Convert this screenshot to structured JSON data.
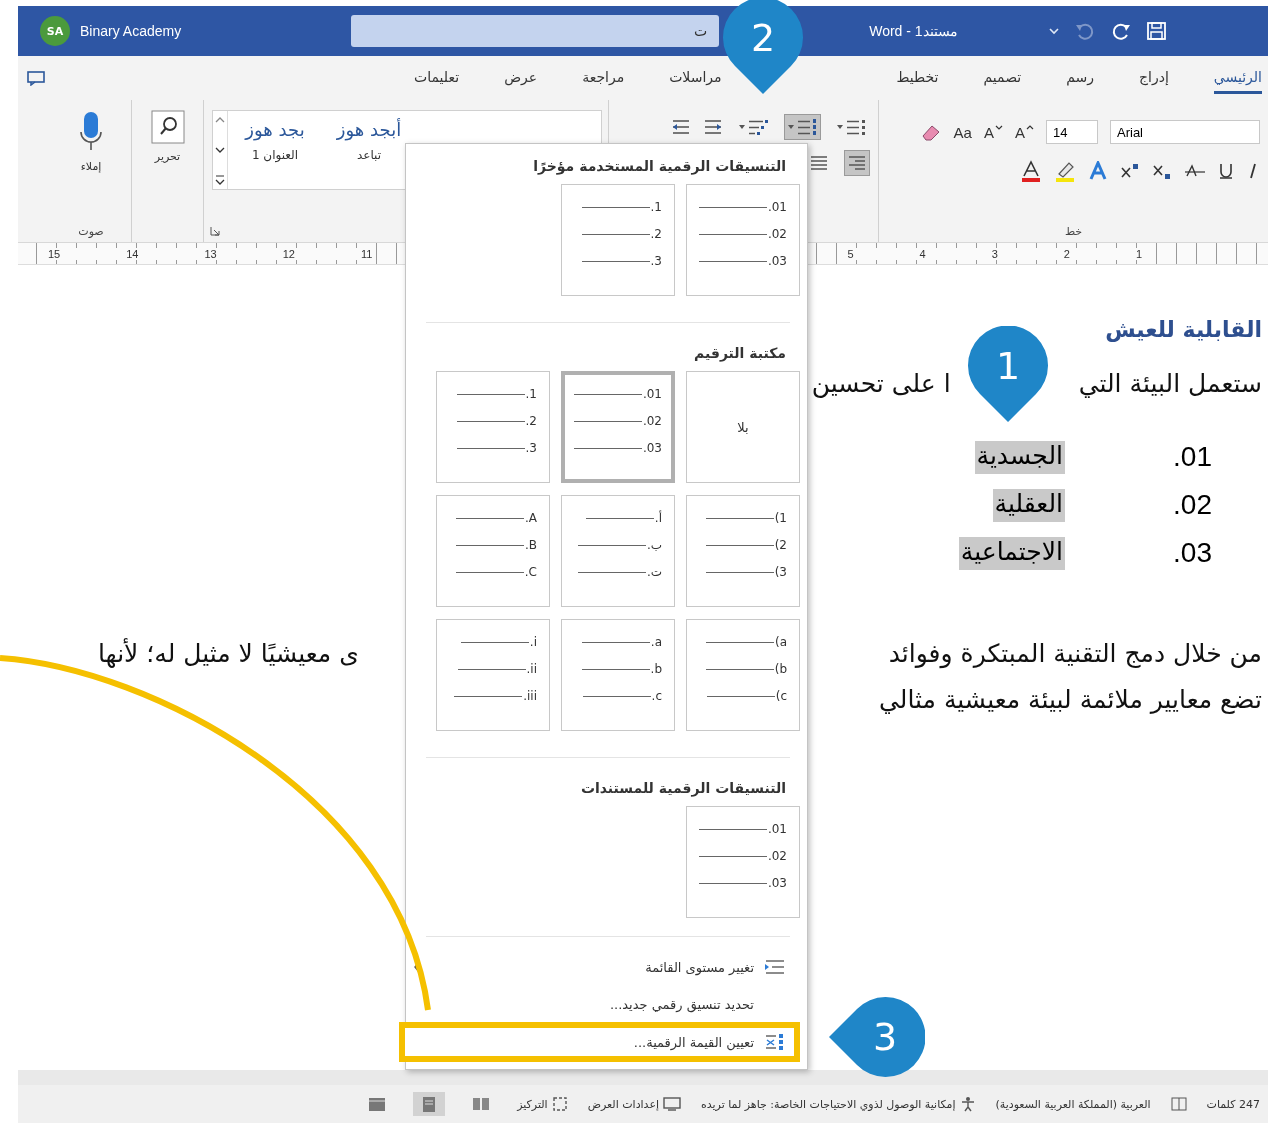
{
  "title_bar": {
    "avatar": "SA",
    "account": "Binary Academy",
    "search_text": "ت",
    "document_title": "Word - مستند1"
  },
  "tabs": [
    {
      "label": "الرئيسي",
      "selected": true
    },
    {
      "label": "إدراج",
      "selected": false
    },
    {
      "label": "رسم",
      "selected": false
    },
    {
      "label": "تصميم",
      "selected": false
    },
    {
      "label": "تخطيط",
      "selected": false
    },
    {
      "label": "مراسلات",
      "selected": false
    },
    {
      "label": "مراجعة",
      "selected": false
    },
    {
      "label": "عرض",
      "selected": false
    },
    {
      "label": "تعليمات",
      "selected": false
    }
  ],
  "ribbon": {
    "font": {
      "font_name": "Arial",
      "font_size": "14",
      "buttons": [
        {
          "kind": "grow",
          "label": "A"
        },
        {
          "kind": "shrink",
          "label": "A"
        },
        {
          "kind": "case",
          "label": "Aa"
        }
      ],
      "group_label": "خط"
    },
    "paragraph": {
      "list_buttons": [
        {
          "kind": "bullets",
          "selected": false
        },
        {
          "kind": "numbering",
          "selected": true
        },
        {
          "kind": "multilevel",
          "selected": false
        }
      ],
      "align_buttons": [
        {
          "kind": "align-right",
          "selected": true
        },
        {
          "kind": "justify",
          "selected": false
        }
      ]
    },
    "styles": [
      {
        "sample": "أبجد هوز",
        "name": "تباعد"
      },
      {
        "sample": "بجد هوز",
        "name": "العنوان 1"
      }
    ],
    "editing": {
      "label": "تحرير"
    },
    "voice": {
      "button": "إملاء",
      "group_label": "صوت"
    }
  },
  "ruler": {
    "right_numbers": [
      "1",
      "2",
      "3",
      "4",
      "5"
    ],
    "left_numbers": [
      "11",
      "12",
      "13",
      "14",
      "15"
    ]
  },
  "document": {
    "heading": "القابلية للعيش",
    "intro_parts": [
      "ستعمل البيئة التي",
      "ا على تحسين"
    ],
    "list_items": [
      {
        "number": "01.",
        "text": "الجسدية"
      },
      {
        "number": "02.",
        "text": "العقلية"
      },
      {
        "number": "03.",
        "text": "الاجتماعية"
      }
    ],
    "paragraph_lines": [
      {
        "right": "من خلال دمج التقنية المبتكرة وفوائد",
        "left": "ى معيشيًا لا مثيل له؛ لأنها"
      },
      {
        "right": "تضع معايير ملائمة لبيئة معيشية مثالي"
      }
    ]
  },
  "numbering_menu": {
    "sections": [
      {
        "title": "التنسيقات الرقمية المستخدمة مؤخرًا",
        "tiles": [
          {
            "kind": "list",
            "markers": [
              "01.",
              "02.",
              "03."
            ],
            "selected": false
          },
          {
            "kind": "list",
            "markers": [
              "1.",
              "2.",
              "3."
            ],
            "selected": false
          }
        ]
      },
      {
        "title": "مكتبة الترقيم",
        "tiles": [
          {
            "kind": "none",
            "label": "بلا",
            "selected": false
          },
          {
            "kind": "list",
            "markers": [
              "01.",
              "02.",
              "03."
            ],
            "selected": true
          },
          {
            "kind": "list",
            "markers": [
              "1.",
              "2.",
              "3."
            ],
            "selected": false
          },
          {
            "kind": "list",
            "markers": [
              "1)",
              "2)",
              "3)"
            ],
            "selected": false
          },
          {
            "kind": "list",
            "markers": [
              "أ.",
              "ب.",
              "ت."
            ],
            "selected": false
          },
          {
            "kind": "list",
            "markers": [
              "A.",
              "B.",
              "C."
            ],
            "selected": false
          },
          {
            "kind": "list",
            "markers": [
              "a)",
              "b)",
              "c)"
            ],
            "selected": false
          },
          {
            "kind": "list",
            "markers": [
              "a.",
              "b.",
              "c."
            ],
            "selected": false
          },
          {
            "kind": "list",
            "markers": [
              "i.",
              "ii.",
              "iii."
            ],
            "selected": false
          }
        ]
      },
      {
        "title": "التنسيقات الرقمية للمستندات",
        "tiles": [
          {
            "kind": "list",
            "markers": [
              "01.",
              "02.",
              "03."
            ],
            "selected": false
          }
        ]
      }
    ],
    "menu_items": [
      {
        "kind": "level",
        "label": "تغيير مستوى القائمة",
        "submenu": true,
        "highlighted": false
      },
      {
        "kind": "plain",
        "label": "تحديد تنسيق رقمي جديد...",
        "submenu": false,
        "highlighted": false
      },
      {
        "kind": "value",
        "label": "تعيين القيمة الرقمية...",
        "submenu": false,
        "highlighted": true
      }
    ]
  },
  "status_bar": {
    "words": "247 كلمات",
    "language": "العربية (المملكة العربية السعودية)",
    "accessibility": "إمكانية الوصول لذوي الاحتياجات الخاصة: جاهز لما تريده",
    "display_settings": "إعدادات العرض",
    "focus": "التركيز",
    "views": [
      {
        "kind": "read",
        "selected": false
      },
      {
        "kind": "print",
        "selected": true
      },
      {
        "kind": "web",
        "selected": false
      }
    ]
  },
  "callouts": [
    {
      "number": "1",
      "kind": "down"
    },
    {
      "number": "2",
      "kind": "down"
    },
    {
      "number": "3",
      "kind": "left"
    }
  ]
}
